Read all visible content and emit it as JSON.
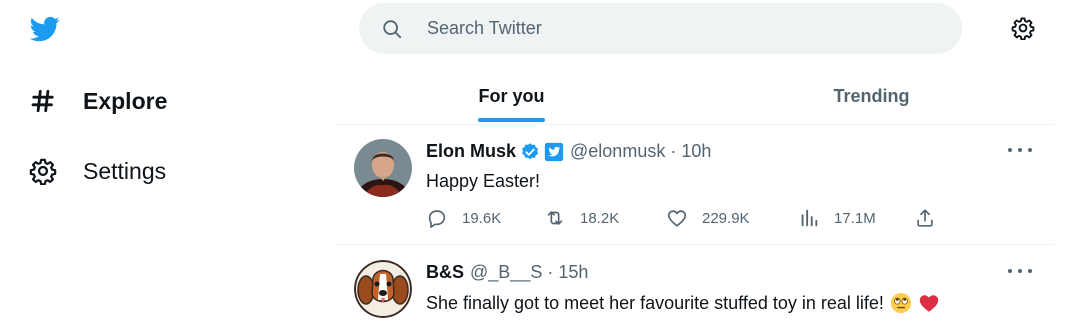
{
  "nav": {
    "logo_icon": "twitter-bird-icon",
    "items": [
      {
        "label": "Explore",
        "icon": "hashtag-icon"
      },
      {
        "label": "Settings",
        "icon": "gear-icon"
      }
    ]
  },
  "search": {
    "placeholder": "Search Twitter",
    "icon": "search-icon"
  },
  "header": {
    "settings_icon": "gear-icon"
  },
  "tabs": [
    {
      "label": "For you",
      "active": true
    },
    {
      "label": "Trending",
      "active": false
    }
  ],
  "tweets": [
    {
      "name": "Elon Musk",
      "handle": "@elonmusk",
      "separator": "·",
      "time": "10h",
      "text": "Happy Easter!",
      "stats": {
        "replies": "19.6K",
        "retweets": "18.2K",
        "likes": "229.9K",
        "views": "17.1M"
      }
    },
    {
      "name": "B&S",
      "handle": "@_B__S",
      "separator": "·",
      "time": "15h",
      "text": "She finally got to meet her favourite stuffed toy in real life!",
      "emojis": [
        "face-with-rolling-eyes",
        "red-heart"
      ]
    }
  ],
  "colors": {
    "accent": "#1d9bf0",
    "text": "#0f1419",
    "muted": "#536471",
    "search_bg": "#eff3f4"
  }
}
